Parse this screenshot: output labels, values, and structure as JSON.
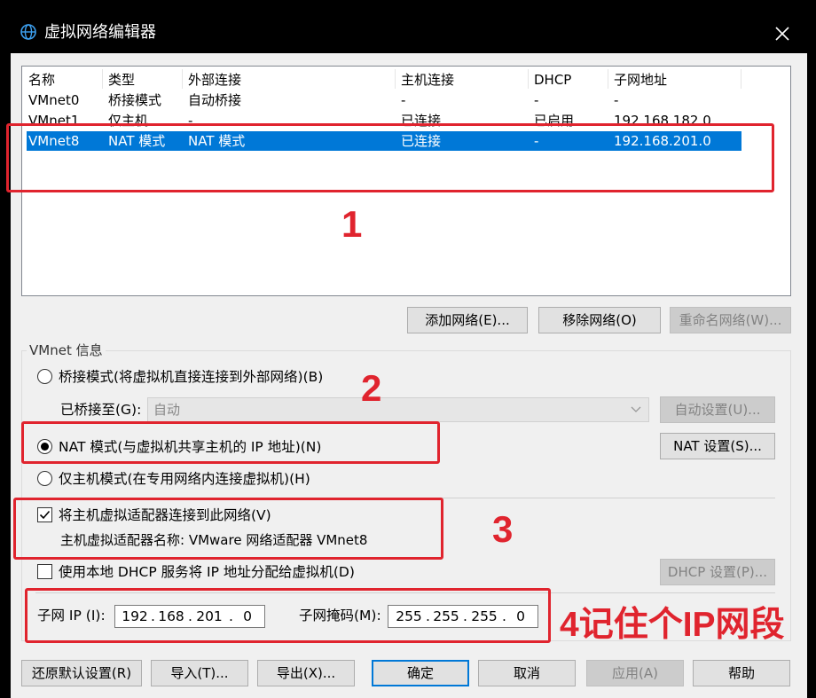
{
  "window": {
    "title": "虚拟网络编辑器",
    "icon": "globe-icon",
    "close_icon": "close-icon"
  },
  "network_table": {
    "columns": [
      "名称",
      "类型",
      "外部连接",
      "主机连接",
      "DHCP",
      "子网地址"
    ],
    "rows": [
      {
        "name": "VMnet0",
        "type": "桥接模式",
        "external": "自动桥接",
        "host": "-",
        "dhcp": "-",
        "subnet": "-",
        "selected": false
      },
      {
        "name": "VMnet1",
        "type": "仅主机",
        "external": "-",
        "host": "已连接",
        "dhcp": "已启用",
        "subnet": "192.168.182.0",
        "selected": false
      },
      {
        "name": "VMnet8",
        "type": "NAT 模式",
        "external": "NAT 模式",
        "host": "已连接",
        "dhcp": "-",
        "subnet": "192.168.201.0",
        "selected": true
      }
    ]
  },
  "table_buttons": {
    "add": "添加网络(E)...",
    "remove": "移除网络(O)",
    "rename": "重命名网络(W)..."
  },
  "vmnet_info": {
    "group_label": "VMnet 信息",
    "bridged_radio": "桥接模式(将虚拟机直接连接到外部网络)(B)",
    "bridged_to_label": "已桥接至(G):",
    "bridged_to_value": "自动",
    "auto_settings_button": "自动设置(U)...",
    "nat_radio": "NAT 模式(与虚拟机共享主机的 IP 地址)(N)",
    "nat_settings_button": "NAT 设置(S)...",
    "host_only_radio": "仅主机模式(在专用网络内连接虚拟机)(H)",
    "selected_mode": "NAT",
    "connect_adapter_checkbox": "将主机虚拟适配器连接到此网络(V)",
    "connect_adapter_checked": true,
    "adapter_name_text": "主机虚拟适配器名称: VMware 网络适配器 VMnet8",
    "dhcp_checkbox": "使用本地 DHCP 服务将 IP 地址分配给虚拟机(D)",
    "dhcp_checked": false,
    "dhcp_settings_button": "DHCP 设置(P)...",
    "subnet_ip_label": "子网 IP (I):",
    "subnet_ip": [
      "192",
      "168",
      "201",
      "0"
    ],
    "subnet_mask_label": "子网掩码(M):",
    "subnet_mask": [
      "255",
      "255",
      "255",
      "0"
    ]
  },
  "bottom_buttons": {
    "restore": "还原默认设置(R)",
    "import": "导入(T)...",
    "export": "导出(X)...",
    "ok": "确定",
    "cancel": "取消",
    "apply": "应用(A)",
    "help": "帮助"
  },
  "annotations": {
    "color": "#e0242e",
    "label_1": "1",
    "label_2": "2",
    "label_3": "3",
    "label_4": "4记住个IP网段"
  },
  "colors": {
    "selection": "#0078d7",
    "window_bg": "#f0f0f0",
    "titlebar": "#000000"
  }
}
